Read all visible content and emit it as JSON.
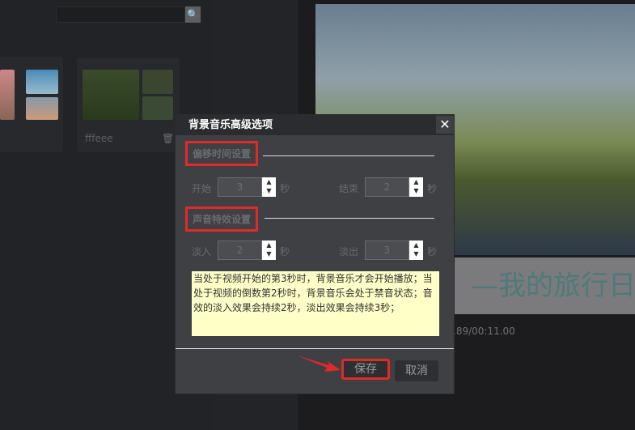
{
  "library": {
    "search_placeholder": "",
    "folder_name": "fffeee"
  },
  "preview": {
    "caption": "—我的旅行日",
    "time": ".89/00:11.00"
  },
  "dialog": {
    "title": "背景音乐高级选项",
    "close": "✕",
    "offset_section": "偏移时间设置",
    "start_label": "开始",
    "start_value": "3",
    "end_label": "结束",
    "end_value": "2",
    "effect_section": "声音特效设置",
    "fadein_label": "淡入",
    "fadein_value": "2",
    "fadeout_label": "淡出",
    "fadeout_value": "3",
    "unit": "秒",
    "note": "当处于视频开始的第3秒时，背景音乐才会开始播放；当处于视频的倒数第2秒时，背景音乐会处于禁音状态；音效的淡入效果会持续2秒，淡出效果会持续3秒；",
    "save": "保存",
    "cancel": "取消"
  },
  "colors": {
    "highlight": "#e02a2a",
    "note_bg": "#ffffc8"
  }
}
